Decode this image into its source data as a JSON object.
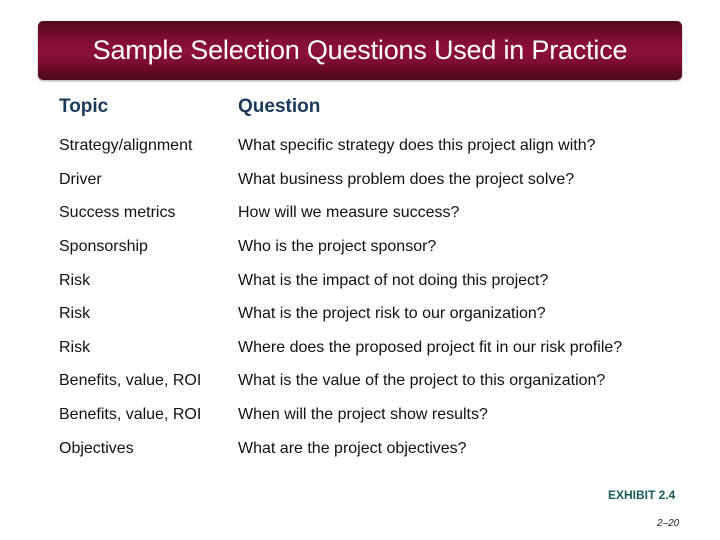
{
  "title": "Sample Selection Questions Used in Practice",
  "table": {
    "headers": {
      "topic": "Topic",
      "question": "Question"
    },
    "rows": [
      {
        "topic": "Strategy/alignment",
        "question": "What specific strategy does this project align with?"
      },
      {
        "topic": "Driver",
        "question": "What business problem does the project solve?"
      },
      {
        "topic": "Success metrics",
        "question": "How will we measure success?"
      },
      {
        "topic": "Sponsorship",
        "question": "Who is the project sponsor?"
      },
      {
        "topic": "Risk",
        "question": "What is the impact of not doing this project?"
      },
      {
        "topic": "Risk",
        "question": "What is the project risk to our organization?"
      },
      {
        "topic": "Risk",
        "question": "Where does the proposed project fit in our risk profile?"
      },
      {
        "topic": "Benefits, value, ROI",
        "question": "What is the value of the project to this organization?"
      },
      {
        "topic": "Benefits, value, ROI",
        "question": "When will the project show results?"
      },
      {
        "topic": "Objectives",
        "question": "What are the project objectives?"
      }
    ]
  },
  "exhibit_label": "EXHIBIT 2.4",
  "page_number": "2–20",
  "colors": {
    "title_bar": "#7e0d30",
    "header_text": "#1a3a5c",
    "exhibit_text": "#1a5a5a"
  }
}
